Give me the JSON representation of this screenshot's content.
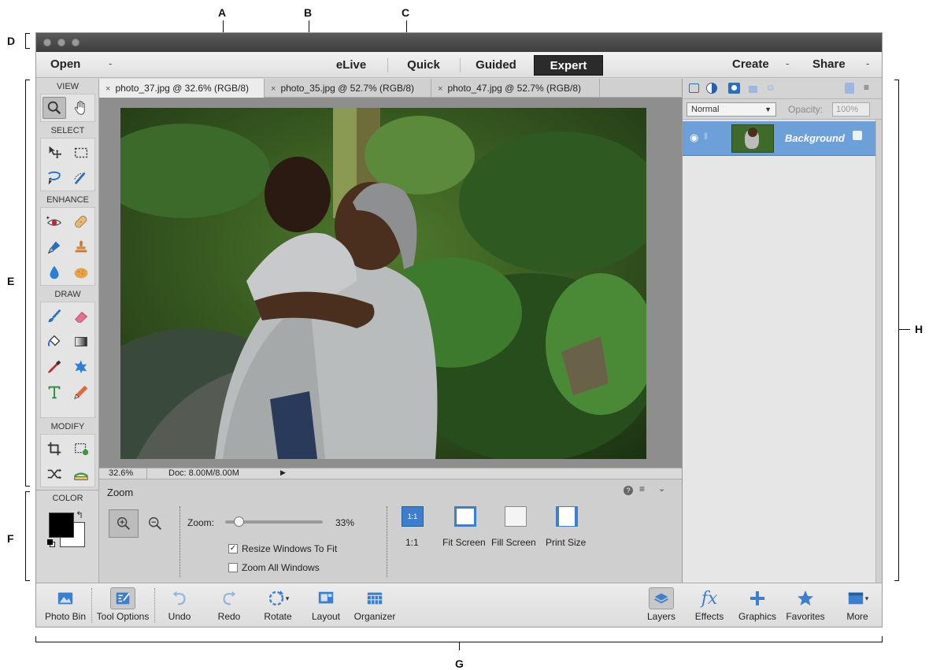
{
  "callouts": {
    "a": "A",
    "b": "B",
    "c": "C",
    "d": "D",
    "e": "E",
    "f": "F",
    "g": "G",
    "h": "H"
  },
  "menu": {
    "open": "Open",
    "open_arrow": "-",
    "modes": [
      "eLive",
      "Quick",
      "Guided",
      "Expert"
    ],
    "active_mode": "Expert",
    "create": "Create",
    "share": "Share",
    "arrow": "-"
  },
  "toolbox": {
    "sections": [
      "VIEW",
      "SELECT",
      "ENHANCE",
      "DRAW",
      "MODIFY"
    ],
    "color_label": "COLOR"
  },
  "tabs": [
    {
      "label": "photo_37.jpg @ 32.6% (RGB/8)",
      "active": true
    },
    {
      "label": "photo_35.jpg @ 52.7% (RGB/8)",
      "active": false
    },
    {
      "label": "photo_47.jpg @ 52.7% (RGB/8)",
      "active": false
    }
  ],
  "tab_close": "×",
  "status": {
    "zoom": "32.6%",
    "doc": "Doc: 8.00M/8.00M",
    "arrow": "▶"
  },
  "tool_options": {
    "title": "Zoom",
    "zoom_label": "Zoom:",
    "zoom_value": "33%",
    "zoom_slider_fraction": 0.1,
    "resize_windows": {
      "label": "Resize Windows To Fit",
      "checked": true
    },
    "zoom_all": {
      "label": "Zoom All Windows",
      "checked": false
    },
    "presets": [
      {
        "label": "1:1",
        "icon_text": "1:1"
      },
      {
        "label": "Fit Screen"
      },
      {
        "label": "Fill Screen"
      },
      {
        "label": "Print Size"
      }
    ]
  },
  "layers": {
    "blend_mode": "Normal",
    "opacity_label": "Opacity:",
    "opacity_value": "100%",
    "items": [
      {
        "name": "Background",
        "selected": true
      }
    ]
  },
  "taskbar": {
    "left": [
      "Photo Bin",
      "Tool Options",
      "Undo",
      "Redo",
      "Rotate",
      "Layout",
      "Organizer"
    ],
    "right": [
      "Layers",
      "Effects",
      "Graphics",
      "Favorites",
      "More"
    ],
    "effects_icon_text": "fx"
  },
  "colors": {
    "accent": "#6d9fd8",
    "active_mode_bg": "#2b2b2b",
    "chrome": "#d9d9d9"
  }
}
